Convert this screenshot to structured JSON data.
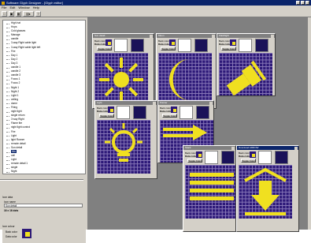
{
  "window": {
    "title": "Software Glyph Designer - [Glyph editor]"
  },
  "menu": [
    "File",
    "Edit",
    "Window",
    "Help"
  ],
  "toolbar": {
    "buttons": [
      "new",
      "open",
      "save",
      "copy",
      "help"
    ]
  },
  "tree": {
    "items": [
      "High hat",
      "Hops",
      "Cold glasses",
      "Manage",
      "candle",
      "3-way Right cable light",
      "3-way Right cable light left",
      "Fire",
      "Day 1",
      "Day 2",
      "Day 3",
      "candle 1",
      "candle 2",
      "candle 3",
      "Focus 1",
      "Focus 2",
      "Night 1",
      "Night 2",
      "Light 1",
      "ceiling",
      "dome",
      "Firing",
      "night light",
      "single return",
      "3 way Right",
      "Flame fire",
      "night light control",
      "Fire",
      "Light",
      "light Runner",
      "remote detail",
      "Sun detail",
      "Mix",
      "call",
      "Light",
      "remote detail 1",
      "single",
      "Night",
      "detail",
      "retrieved",
      "Moon",
      "Nut 1",
      "fire",
      "desklite"
    ],
    "selected_index": 32
  },
  "properties": {
    "group_title": "Icon data",
    "name_label": "Icon name",
    "name_value": "Sun detail",
    "size": "16 x 16 dots",
    "highlight_title": "Icon colour",
    "back_color_label": "Back color",
    "data_color_label": "Data color"
  },
  "colors": {
    "back": "#2c1878",
    "data": "#f0e020",
    "grid": "#8878b8"
  },
  "editor_windows": [
    {
      "title": "Sun detail",
      "back_label": "Back color",
      "data_label": "Data color",
      "toggle_label": "Toggle Color",
      "icon": "sun-icon"
    },
    {
      "title": "Moon",
      "back_label": "Back color",
      "data_label": "Data color",
      "toggle_label": "Toggle Color",
      "icon": "moon-icon"
    },
    {
      "title": "Flashlight",
      "back_label": "Back color",
      "data_label": "Data color",
      "toggle_label": "Toggle Color",
      "icon": "flashlight-icon"
    },
    {
      "title": "Light",
      "back_label": "Back color",
      "data_label": "Data color",
      "toggle_label": "Toggle Color",
      "icon": "bulb-icon"
    },
    {
      "title": "Pointer",
      "back_label": "Back color",
      "data_label": "Data color",
      "toggle_label": "Toggle Color",
      "icon": "arrow-right-icon"
    },
    {
      "title": "Stack",
      "back_label": "Back color",
      "data_label": "Data color",
      "toggle_label": "Toggle Color",
      "icon": "stack-icon"
    },
    {
      "title": "Download ARROW",
      "back_label": "Back color",
      "data_label": "Data color",
      "toggle_label": "Toggle Color",
      "icon": "arrow-down-icon"
    }
  ]
}
